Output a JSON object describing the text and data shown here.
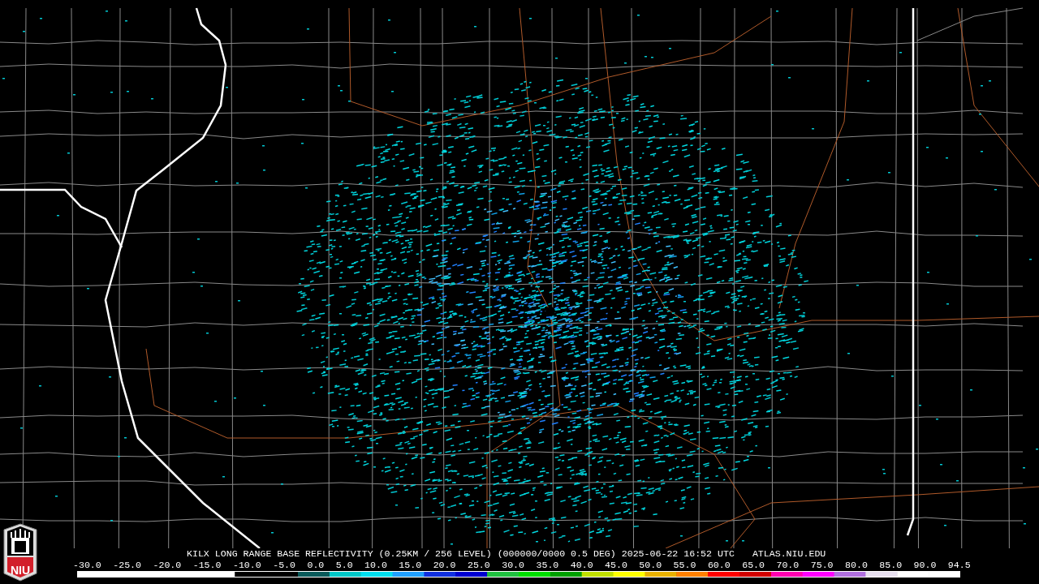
{
  "logo": {
    "text": "NIU"
  },
  "caption": {
    "product": "KILX LONG RANGE BASE REFLECTIVITY (0.25KM / 256 LEVEL) (000000/0000 0.5 DEG) 2025-06-22 16:52 UTC",
    "site": "ATLAS.NIU.EDU"
  },
  "scale": {
    "labels": [
      "-30.0",
      "-25.0",
      "-20.0",
      "-15.0",
      "-10.0",
      "-5.0",
      "0.0",
      "5.0",
      "10.0",
      "15.0",
      "20.0",
      "25.0",
      "30.0",
      "35.0",
      "40.0",
      "45.0",
      "50.0",
      "55.0",
      "60.0",
      "65.0",
      "70.0",
      "75.0",
      "80.0",
      "85.0",
      "90.0",
      "94.5"
    ]
  }
}
